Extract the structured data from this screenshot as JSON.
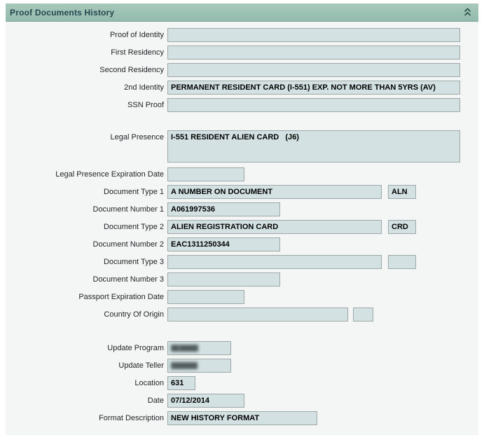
{
  "header": {
    "title": "Proof Documents History",
    "collapse_icon": "chevron-double-up"
  },
  "colors": {
    "header_background": "#9bc0b2",
    "header_title": "#28464f",
    "panel_body_background": "#f4f5f5",
    "field_background": "#d3e1e2",
    "field_border": "#9da8a8",
    "field_text": "#000000",
    "label_text": "#1f2324"
  },
  "fields": [
    {
      "key": "proof-of-identity",
      "label": "Proof of Identity",
      "value": "",
      "size": "full"
    },
    {
      "key": "first-residency",
      "label": "First Residency",
      "value": "",
      "size": "full"
    },
    {
      "key": "second-residency",
      "label": "Second Residency",
      "value": "",
      "size": "full"
    },
    {
      "key": "2nd-identity",
      "label": "2nd Identity",
      "value": "PERMANENT RESIDENT CARD (I-551) EXP. NOT MORE THAN 5YRS (AV)",
      "size": "full"
    },
    {
      "key": "ssn-proof",
      "label": "SSN Proof",
      "value": "",
      "size": "full"
    },
    {
      "key": "legal-presence",
      "label": "Legal Presence",
      "value": "I-551 RESIDENT ALIEN CARD   (J6)",
      "size": "full",
      "tall": true
    },
    {
      "key": "legal-presence-expiration-date",
      "label": "Legal Presence Expiration Date",
      "value": "",
      "size": "sm"
    },
    {
      "key": "document-type-1",
      "label": "Document Type 1",
      "value": "A NUMBER ON DOCUMENT",
      "size": "doctype",
      "aux": {
        "value": "ALN",
        "size": "code"
      }
    },
    {
      "key": "document-number-1",
      "label": "Document Number 1",
      "value": "A061997536",
      "size": "docnum"
    },
    {
      "key": "document-type-2",
      "label": "Document Type 2",
      "value": "ALIEN REGISTRATION CARD",
      "size": "doctype",
      "aux": {
        "value": "CRD",
        "size": "code"
      }
    },
    {
      "key": "document-number-2",
      "label": "Document Number 2",
      "value": "EAC1311250344",
      "size": "docnum"
    },
    {
      "key": "document-type-3",
      "label": "Document Type 3",
      "value": "",
      "size": "doctype",
      "aux": {
        "value": "",
        "size": "code"
      }
    },
    {
      "key": "document-number-3",
      "label": "Document Number 3",
      "value": "",
      "size": "docnum"
    },
    {
      "key": "passport-expiration-date",
      "label": "Passport Expiration Date",
      "value": "",
      "size": "sm"
    },
    {
      "key": "country-of-origin",
      "label": "Country Of Origin",
      "value": "",
      "size": "origin",
      "aux": {
        "value": "",
        "size": "tiny"
      }
    },
    {
      "key": "update-program",
      "label": "Update Program",
      "value": "██ █████",
      "size": "prog",
      "redacted": true
    },
    {
      "key": "update-teller",
      "label": "Update Teller",
      "value": "███████",
      "size": "prog",
      "redacted": true
    },
    {
      "key": "location",
      "label": "Location",
      "value": "631",
      "size": "loc"
    },
    {
      "key": "date",
      "label": "Date",
      "value": "07/12/2014",
      "size": "sm"
    },
    {
      "key": "format-description",
      "label": "Format Description",
      "value": "NEW HISTORY FORMAT",
      "size": "fmt"
    }
  ]
}
